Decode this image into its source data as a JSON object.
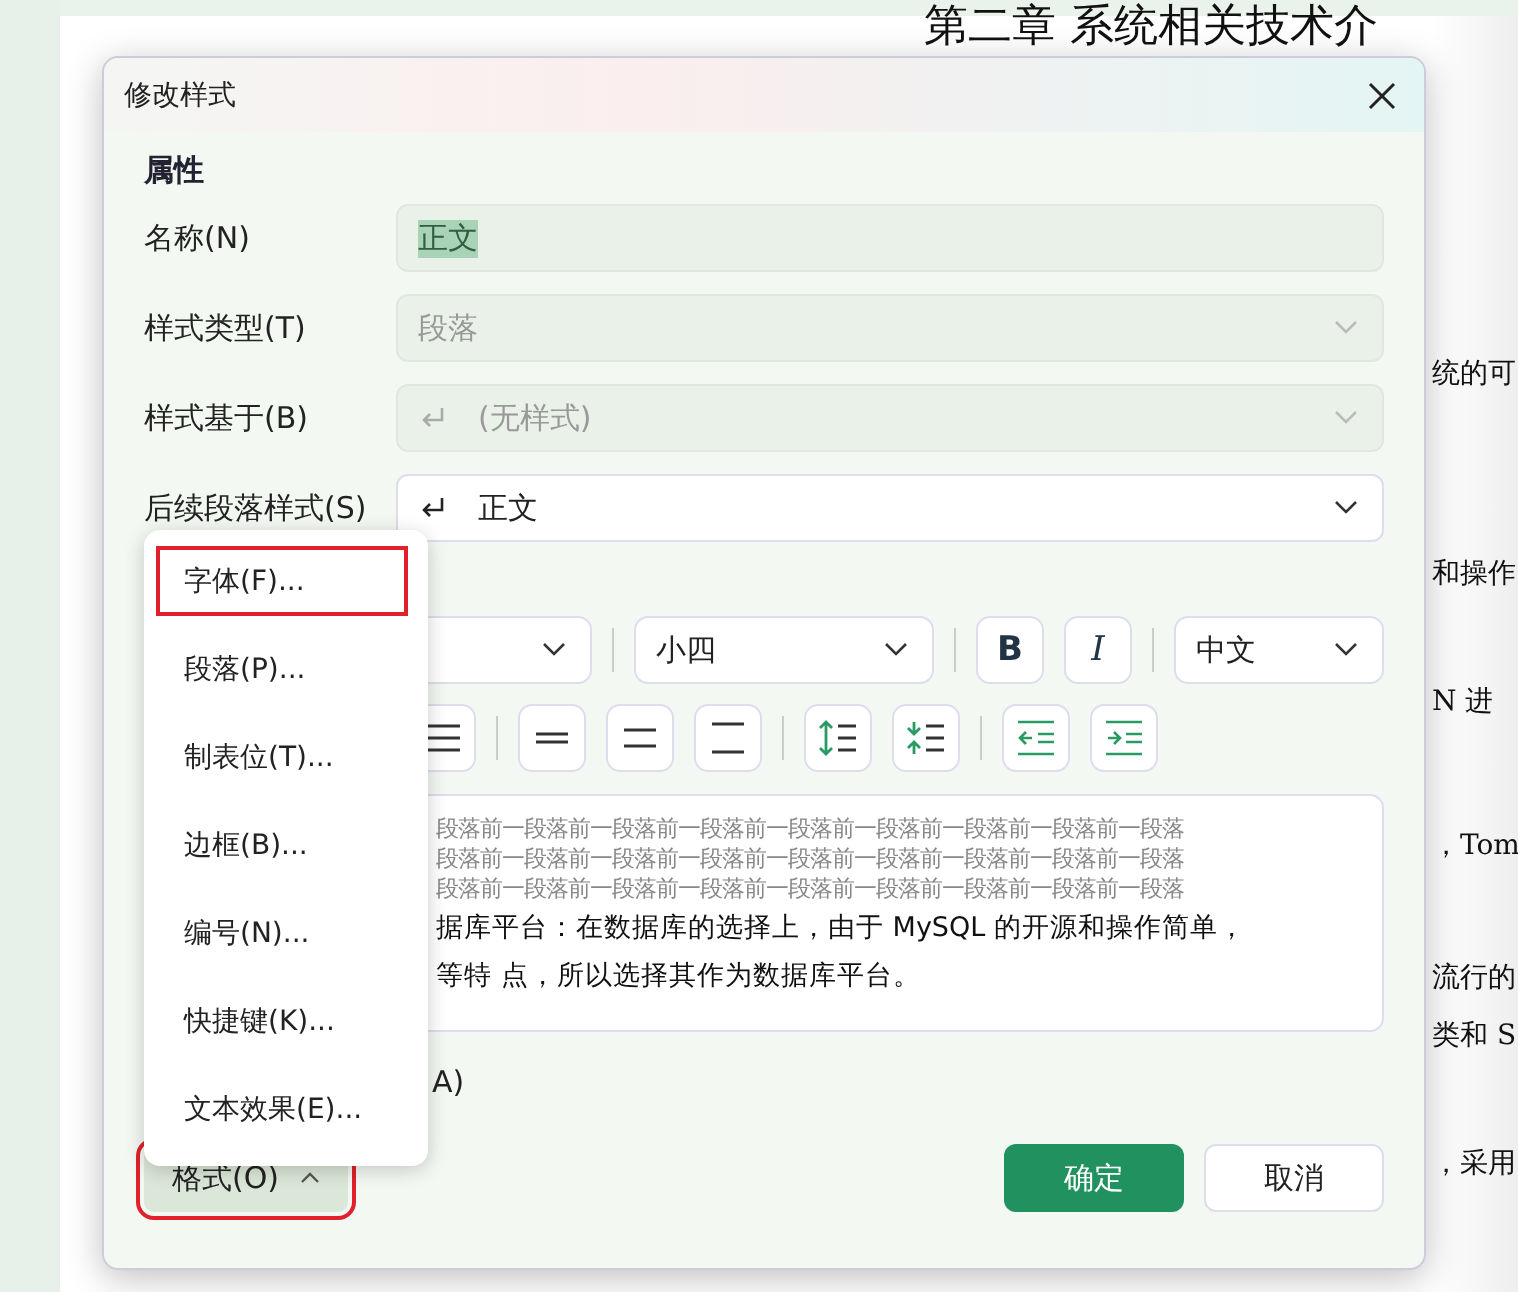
{
  "document": {
    "heading": "第二章  系统相关技术介",
    "fragments": [
      "统的可",
      "和操作",
      "N 进",
      "，Tom",
      "流行的",
      "类和 S",
      "，采用"
    ]
  },
  "window": {
    "title": "修改样式"
  },
  "properties": {
    "title": "属性",
    "fields": [
      {
        "label": "名称(N)",
        "kind": "text",
        "value": "正文",
        "disabled": true,
        "text_selected": true
      },
      {
        "label": "样式类型(T)",
        "kind": "select",
        "value": "段落",
        "disabled": true
      },
      {
        "label": "样式基于(B)",
        "kind": "paragraph-select",
        "value": "(无样式)",
        "disabled": true
      },
      {
        "label": "后续段落样式(S)",
        "kind": "paragraph-select",
        "value": "正文",
        "disabled": false
      }
    ]
  },
  "format_toolbar": {
    "font_size": "小四",
    "bold": "B",
    "italic": "I",
    "language": "中文"
  },
  "preview": {
    "before_lines": [
      "段落前一段落前一段落前一段落前一段落前一段落前一段落前一段落前一段落",
      "段落前一段落前一段落前一段落前一段落前一段落前一段落前一段落前一段落",
      "段落前一段落前一段落前一段落前一段落前一段落前一段落前一段落前一段落"
    ],
    "sample_lines": [
      "据库平台：在数据库的选择上，由于 MySQL 的开源和操作简单，",
      "等特 点，所以选择其作为数据库平台。"
    ]
  },
  "add_to_gallery": {
    "label": "A)"
  },
  "menu": {
    "items": [
      {
        "label": "字体(F)...",
        "highlighted": true
      },
      {
        "label": "段落(P)...",
        "highlighted": false
      },
      {
        "label": "制表位(T)...",
        "highlighted": false
      },
      {
        "label": "边框(B)...",
        "highlighted": false
      },
      {
        "label": "编号(N)...",
        "highlighted": false
      },
      {
        "label": "快捷键(K)...",
        "highlighted": false
      },
      {
        "label": "文本效果(E)...",
        "highlighted": false
      }
    ]
  },
  "footer": {
    "format_button": {
      "label": "格式(O)",
      "highlighted": true
    },
    "ok": "确定",
    "cancel": "取消"
  }
}
